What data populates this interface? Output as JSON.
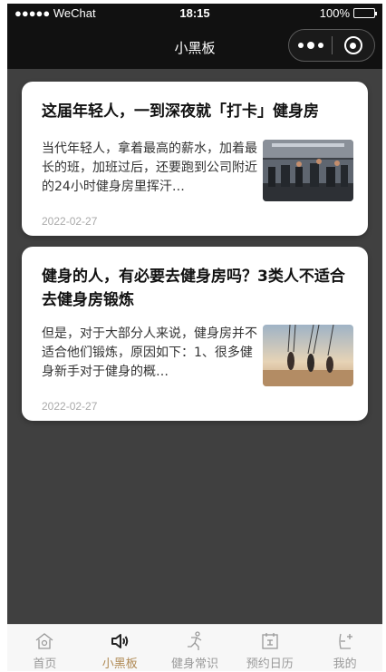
{
  "status_bar": {
    "carrier": "●●●●● WeChat",
    "time": "18:15",
    "battery": "100%"
  },
  "nav": {
    "title": "小黑板"
  },
  "articles": [
    {
      "title": "这届年轻人，一到深夜就「打卡」健身房",
      "excerpt": "当代年轻人，拿着最高的薪水，加着最长的班，加班过后，还要跑到公司附近的24小时健身房里挥汗…",
      "date": "2022-02-27"
    },
    {
      "title": "健身的人，有必要去健身房吗？3类人不适合去健身房锻炼",
      "excerpt": "但是，对于大部分人来说，健身房并不适合他们锻炼，原因如下：1、很多健身新手对于健身的概…",
      "date": "2022-02-27"
    }
  ],
  "tabs": [
    {
      "label": "首页",
      "icon": "home-icon",
      "active": false
    },
    {
      "label": "小黑板",
      "icon": "speaker-icon",
      "active": true
    },
    {
      "label": "健身常识",
      "icon": "fitness-icon",
      "active": false
    },
    {
      "label": "预约日历",
      "icon": "calendar-icon",
      "active": false
    },
    {
      "label": "我的",
      "icon": "profile-icon",
      "active": false
    }
  ],
  "colors": {
    "nav_bg": "#111111",
    "page_bg": "#404040",
    "tab_active": "#b08a55",
    "tab_inactive": "#9a9a9a"
  }
}
